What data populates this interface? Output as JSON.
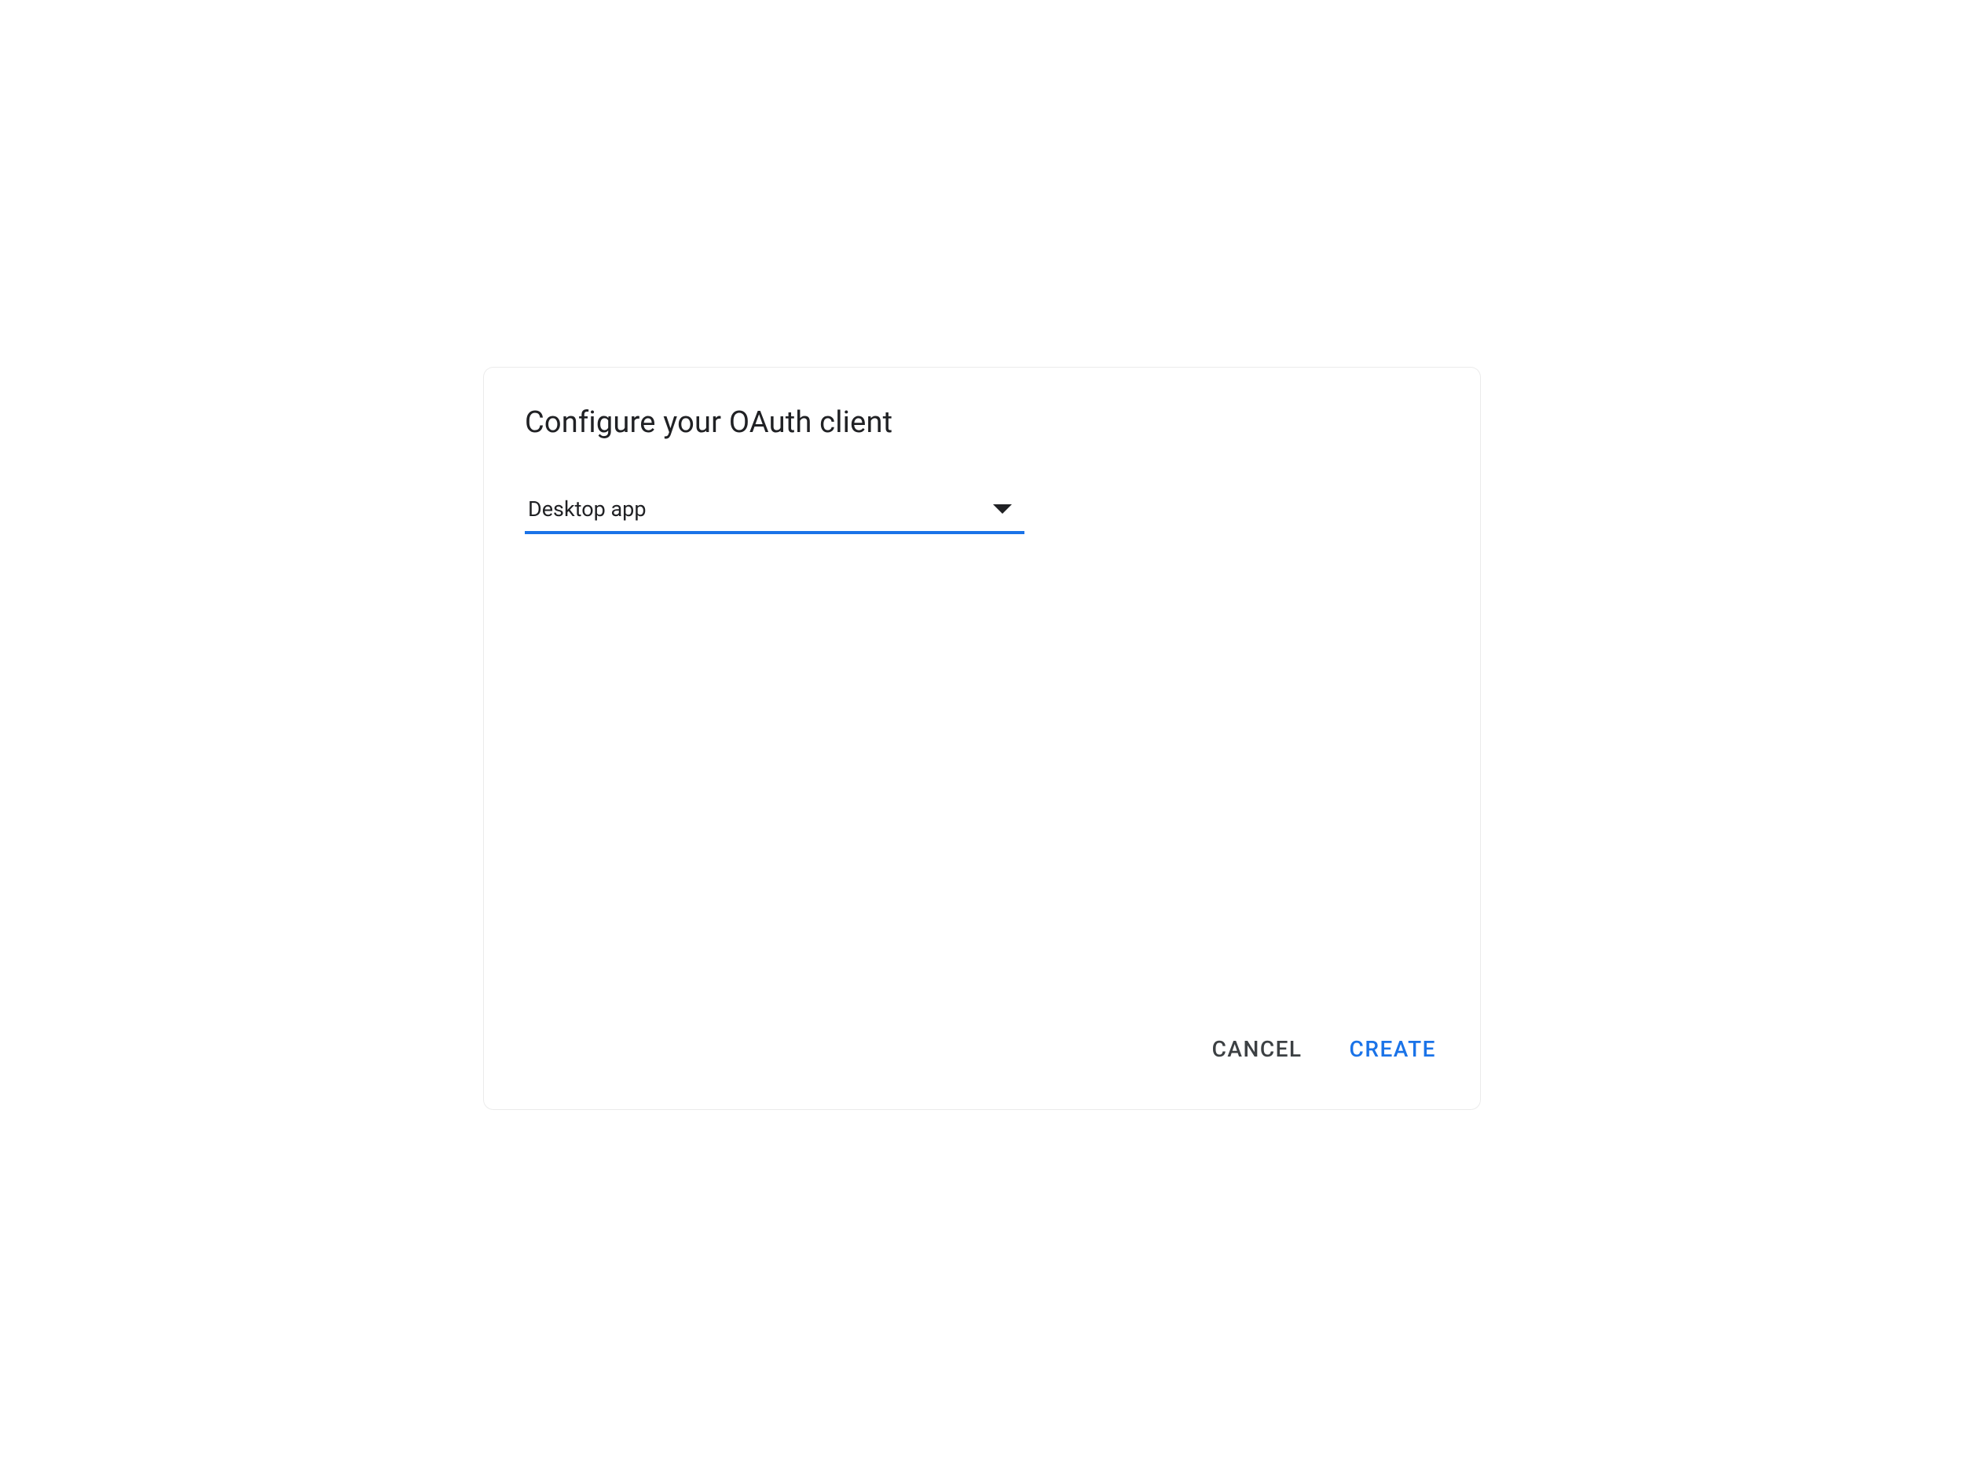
{
  "dialog": {
    "title": "Configure your OAuth client",
    "select": {
      "selected_value": "Desktop app"
    },
    "actions": {
      "cancel_label": "CANCEL",
      "create_label": "CREATE"
    }
  },
  "colors": {
    "primary": "#1a73e8",
    "text": "#202124",
    "text_secondary": "#3c4043"
  }
}
